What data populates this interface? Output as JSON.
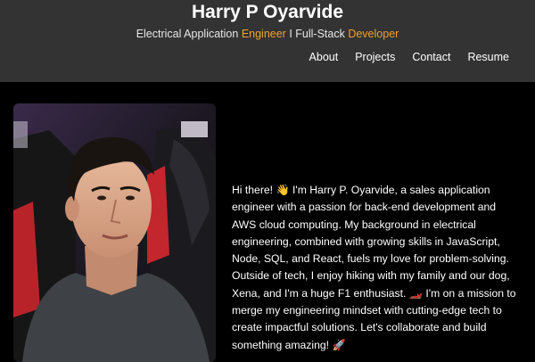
{
  "header": {
    "title": "Harry P Oyarvide",
    "tagline": {
      "part1": "Electrical Application ",
      "accent1": "Engineer",
      "part2": " I Full-Stack ",
      "accent2": "Developer"
    },
    "nav": [
      {
        "label": "About"
      },
      {
        "label": "Projects"
      },
      {
        "label": "Contact"
      },
      {
        "label": "Resume"
      }
    ]
  },
  "colors": {
    "header_bg": "#333333",
    "page_bg": "#000000",
    "accent": "#f0a030",
    "text": "#ffffff"
  },
  "profile": {
    "photo_icon": "portrait-photo"
  },
  "about": {
    "text": "Hi there! 👋 I'm Harry P. Oyarvide, a sales application engineer with a passion for back-end development and AWS cloud computing. My background in electrical engineering, combined with growing skills in JavaScript, Node, SQL, and React, fuels my love for problem-solving. Outside of tech, I enjoy hiking with my family and our dog, Xena, and I'm a huge F1 enthusiast. 🏎️ I'm on a mission to merge my engineering mindset with cutting-edge tech to create impactful solutions. Let's collaborate and build something amazing! 🚀"
  }
}
